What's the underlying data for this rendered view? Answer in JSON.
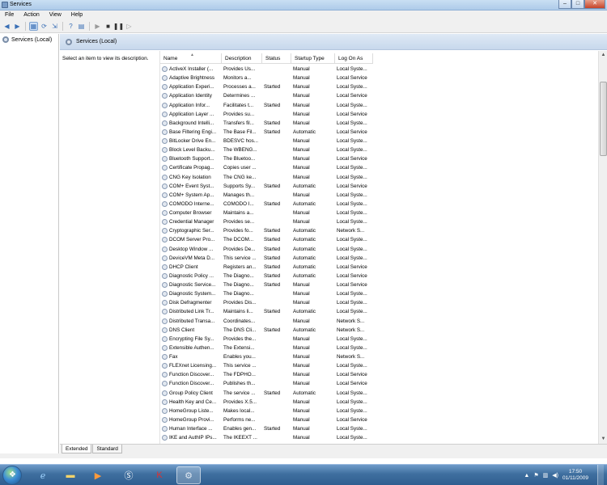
{
  "window": {
    "title": "Services",
    "controls": [
      "–",
      "□",
      "✕"
    ]
  },
  "menu": [
    "File",
    "Action",
    "View",
    "Help"
  ],
  "tree": {
    "root_label": "Services (Local)"
  },
  "header": {
    "title": "Services (Local)"
  },
  "description_hint": "Select an item to view its description.",
  "columns": [
    "Name",
    "Description",
    "Status",
    "Startup Type",
    "Log On As"
  ],
  "rows": [
    {
      "name": "ActiveX Installer (...",
      "desc": "Provides Us...",
      "status": "",
      "startup": "Manual",
      "logon": "Local Syste..."
    },
    {
      "name": "Adaptive Brightness",
      "desc": "Monitors a...",
      "status": "",
      "startup": "Manual",
      "logon": "Local Service"
    },
    {
      "name": "Application Experi...",
      "desc": "Processes a...",
      "status": "Started",
      "startup": "Manual",
      "logon": "Local Syste..."
    },
    {
      "name": "Application Identity",
      "desc": "Determines ...",
      "status": "",
      "startup": "Manual",
      "logon": "Local Service"
    },
    {
      "name": "Application Infor...",
      "desc": "Facilitates t...",
      "status": "Started",
      "startup": "Manual",
      "logon": "Local Syste..."
    },
    {
      "name": "Application Layer ...",
      "desc": "Provides su...",
      "status": "",
      "startup": "Manual",
      "logon": "Local Service"
    },
    {
      "name": "Background Intelli...",
      "desc": "Transfers fil...",
      "status": "Started",
      "startup": "Manual",
      "logon": "Local Syste..."
    },
    {
      "name": "Base Filtering Engi...",
      "desc": "The Base Fil...",
      "status": "Started",
      "startup": "Automatic",
      "logon": "Local Service"
    },
    {
      "name": "BitLocker Drive En...",
      "desc": "BDESVC hos...",
      "status": "",
      "startup": "Manual",
      "logon": "Local Syste..."
    },
    {
      "name": "Block Level Backu...",
      "desc": "The WBENG...",
      "status": "",
      "startup": "Manual",
      "logon": "Local Syste..."
    },
    {
      "name": "Bluetooth Support...",
      "desc": "The Bluetoo...",
      "status": "",
      "startup": "Manual",
      "logon": "Local Service"
    },
    {
      "name": "Certificate Propag...",
      "desc": "Copies user ...",
      "status": "",
      "startup": "Manual",
      "logon": "Local Syste..."
    },
    {
      "name": "CNG Key Isolation",
      "desc": "The CNG ke...",
      "status": "",
      "startup": "Manual",
      "logon": "Local Syste..."
    },
    {
      "name": "COM+ Event Syst...",
      "desc": "Supports Sy...",
      "status": "Started",
      "startup": "Automatic",
      "logon": "Local Service"
    },
    {
      "name": "COM+ System Ap...",
      "desc": "Manages th...",
      "status": "",
      "startup": "Manual",
      "logon": "Local Syste..."
    },
    {
      "name": "COMODO Interne...",
      "desc": "COMODO I...",
      "status": "Started",
      "startup": "Automatic",
      "logon": "Local Syste..."
    },
    {
      "name": "Computer Browser",
      "desc": "Maintains a...",
      "status": "",
      "startup": "Manual",
      "logon": "Local Syste..."
    },
    {
      "name": "Credential Manager",
      "desc": "Provides se...",
      "status": "",
      "startup": "Manual",
      "logon": "Local Syste..."
    },
    {
      "name": "Cryptographic Ser...",
      "desc": "Provides fo...",
      "status": "Started",
      "startup": "Automatic",
      "logon": "Network S..."
    },
    {
      "name": "DCOM Server Pro...",
      "desc": "The DCOM...",
      "status": "Started",
      "startup": "Automatic",
      "logon": "Local Syste..."
    },
    {
      "name": "Desktop Window ...",
      "desc": "Provides De...",
      "status": "Started",
      "startup": "Automatic",
      "logon": "Local Syste..."
    },
    {
      "name": "DeviceVM Meta D...",
      "desc": "This service ...",
      "status": "Started",
      "startup": "Automatic",
      "logon": "Local Syste..."
    },
    {
      "name": "DHCP Client",
      "desc": "Registers an...",
      "status": "Started",
      "startup": "Automatic",
      "logon": "Local Service"
    },
    {
      "name": "Diagnostic Policy ...",
      "desc": "The Diagno...",
      "status": "Started",
      "startup": "Automatic",
      "logon": "Local Service"
    },
    {
      "name": "Diagnostic Service...",
      "desc": "The Diagno...",
      "status": "Started",
      "startup": "Manual",
      "logon": "Local Service"
    },
    {
      "name": "Diagnostic System...",
      "desc": "The Diagno...",
      "status": "",
      "startup": "Manual",
      "logon": "Local Syste..."
    },
    {
      "name": "Disk Defragmenter",
      "desc": "Provides Dis...",
      "status": "",
      "startup": "Manual",
      "logon": "Local Syste..."
    },
    {
      "name": "Distributed Link Tr...",
      "desc": "Maintains li...",
      "status": "Started",
      "startup": "Automatic",
      "logon": "Local Syste..."
    },
    {
      "name": "Distributed Transa...",
      "desc": "Coordinates...",
      "status": "",
      "startup": "Manual",
      "logon": "Network S..."
    },
    {
      "name": "DNS Client",
      "desc": "The DNS Cli...",
      "status": "Started",
      "startup": "Automatic",
      "logon": "Network S..."
    },
    {
      "name": "Encrypting File Sy...",
      "desc": "Provides the...",
      "status": "",
      "startup": "Manual",
      "logon": "Local Syste..."
    },
    {
      "name": "Extensible Authen...",
      "desc": "The Extensi...",
      "status": "",
      "startup": "Manual",
      "logon": "Local Syste..."
    },
    {
      "name": "Fax",
      "desc": "Enables you...",
      "status": "",
      "startup": "Manual",
      "logon": "Network S..."
    },
    {
      "name": "FLEXnet Licensing...",
      "desc": "This service ...",
      "status": "",
      "startup": "Manual",
      "logon": "Local Syste..."
    },
    {
      "name": "Function Discover...",
      "desc": "The FDPHO...",
      "status": "",
      "startup": "Manual",
      "logon": "Local Service"
    },
    {
      "name": "Function Discover...",
      "desc": "Publishes th...",
      "status": "",
      "startup": "Manual",
      "logon": "Local Service"
    },
    {
      "name": "Group Policy Client",
      "desc": "The service ...",
      "status": "Started",
      "startup": "Automatic",
      "logon": "Local Syste..."
    },
    {
      "name": "Health Key and Ce...",
      "desc": "Provides X.5...",
      "status": "",
      "startup": "Manual",
      "logon": "Local Syste..."
    },
    {
      "name": "HomeGroup Liste...",
      "desc": "Makes local...",
      "status": "",
      "startup": "Manual",
      "logon": "Local Syste..."
    },
    {
      "name": "HomeGroup Provi...",
      "desc": "Performs ne...",
      "status": "",
      "startup": "Manual",
      "logon": "Local Service"
    },
    {
      "name": "Human Interface ...",
      "desc": "Enables gen...",
      "status": "Started",
      "startup": "Manual",
      "logon": "Local Syste..."
    },
    {
      "name": "IKE and AuthIP IPs...",
      "desc": "The IKEEXT ...",
      "status": "",
      "startup": "Manual",
      "logon": "Local Syste..."
    }
  ],
  "tabs": [
    "Extended",
    "Standard"
  ],
  "taskbar": {
    "clock_time": "17:50",
    "clock_date": "01/11/2009"
  }
}
